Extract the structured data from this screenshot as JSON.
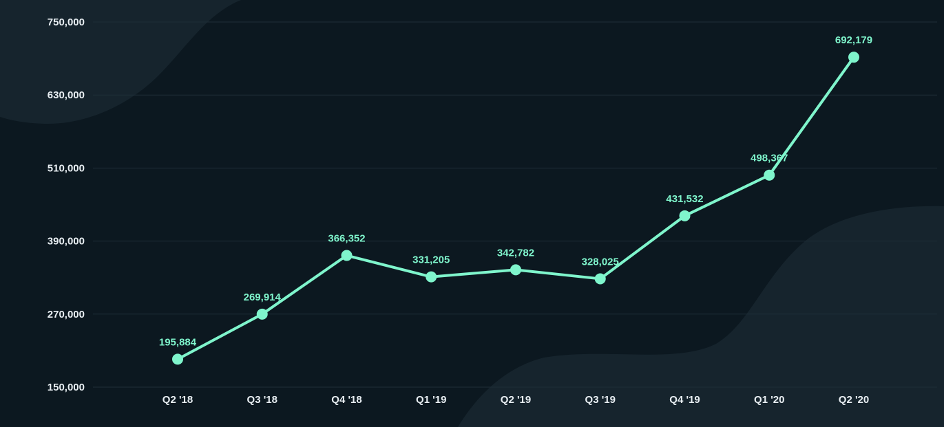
{
  "colors": {
    "background": "#0c1820",
    "decoration": "#16242d",
    "gridline": "#1f2e38",
    "axis_text": "#e8eef2",
    "series": "#7ff5cc"
  },
  "chart_data": {
    "type": "line",
    "title": "",
    "xlabel": "",
    "ylabel": "",
    "categories": [
      "Q2 '18",
      "Q3 '18",
      "Q4 '18",
      "Q1 '19",
      "Q2 '19",
      "Q3 '19",
      "Q4 '19",
      "Q1 '20",
      "Q2 '20"
    ],
    "series": [
      {
        "values": [
          195884,
          269914,
          366352,
          331205,
          342782,
          328025,
          431532,
          498367,
          692179
        ],
        "value_labels": [
          "195,884",
          "269,914",
          "366,352",
          "331,205",
          "342,782",
          "328,025",
          "431,532",
          "498,367",
          "692,179"
        ]
      }
    ],
    "ylim": [
      150000,
      750000
    ],
    "yticks": [
      150000,
      270000,
      390000,
      510000,
      630000,
      750000
    ],
    "ytick_labels": [
      "150,000",
      "270,000",
      "390,000",
      "510,000",
      "630,000",
      "750,000"
    ],
    "grid": true,
    "legend": "none"
  }
}
